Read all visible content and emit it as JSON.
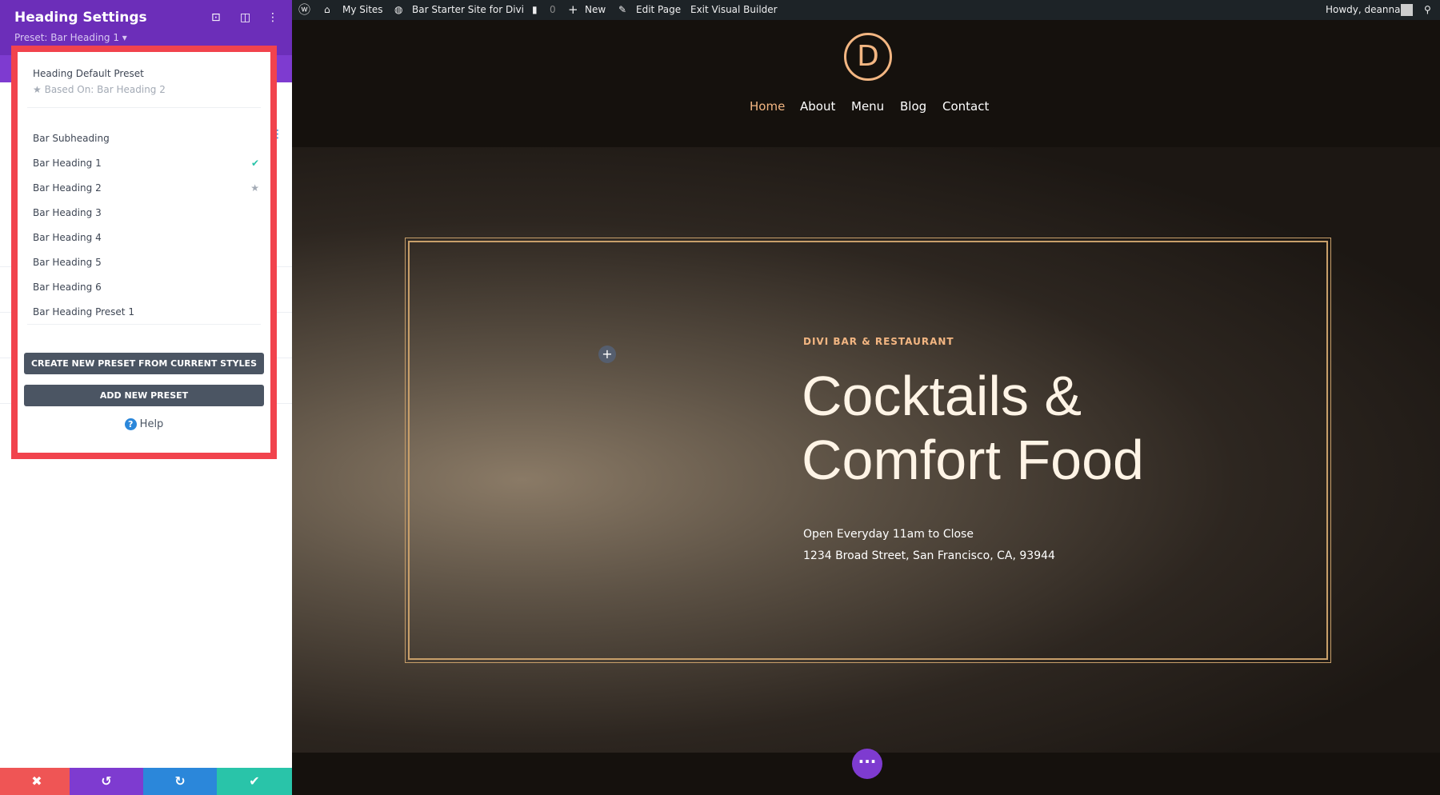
{
  "sidebar": {
    "title": "Heading Settings",
    "preset_label": "Preset: Bar Heading 1 ▾",
    "icons": [
      "screenshot-icon",
      "layout-icon",
      "more-icon"
    ],
    "menu": {
      "default_preset": "Heading Default Preset",
      "based_on": "Based On: Bar Heading 2",
      "items": [
        {
          "label": "Bar Subheading"
        },
        {
          "label": "Bar Heading 1",
          "mark": "check"
        },
        {
          "label": "Bar Heading 2",
          "mark": "star"
        },
        {
          "label": "Bar Heading 3"
        },
        {
          "label": "Bar Heading 4"
        },
        {
          "label": "Bar Heading 5"
        },
        {
          "label": "Bar Heading 6"
        },
        {
          "label": "Bar Heading Preset 1"
        }
      ],
      "create_button": "CREATE NEW PRESET FROM CURRENT STYLES",
      "add_button": "ADD NEW PRESET",
      "help": "Help"
    },
    "footer": {
      "cancel": "✖",
      "undo": "↺",
      "redo": "↻",
      "save": "✔"
    },
    "colors": {
      "purple": "#6c2eb9",
      "cancel": "#ef5555",
      "undo": "#7e3bd0",
      "redo": "#2b87da",
      "save": "#29c4a9",
      "highlight": "#f1434d"
    }
  },
  "adminbar": {
    "my_sites": "My Sites",
    "site": "Bar Starter Site for Divi",
    "comments": "0",
    "new": "New",
    "edit": "Edit Page",
    "exit": "Exit Visual Builder",
    "howdy": "Howdy, deanna"
  },
  "site": {
    "logo": "D",
    "nav": [
      "Home",
      "About",
      "Menu",
      "Blog",
      "Contact"
    ],
    "active_nav": "Home",
    "hero": {
      "subtitle": "DIVI BAR & RESTAURANT",
      "title_line1": "Cocktails &",
      "title_line2": "Comfort Food",
      "line1": "Open Everyday 11am to Close",
      "line2": "1234 Broad Street, San Francisco, CA, 93944"
    },
    "accent": "#f3b682"
  }
}
